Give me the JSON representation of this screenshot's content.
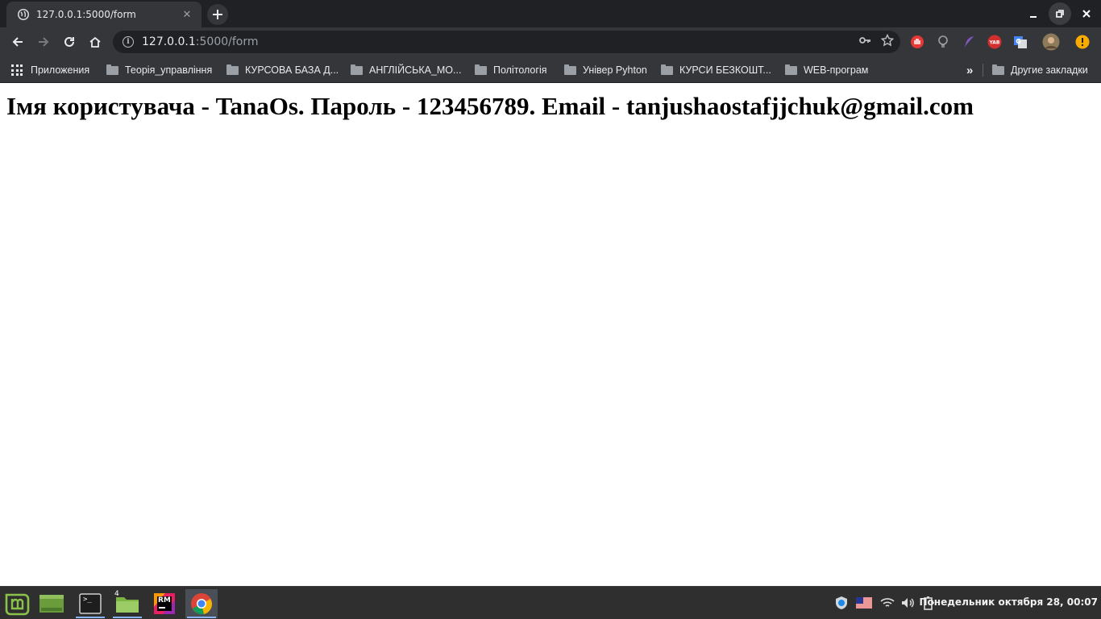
{
  "browser": {
    "tab": {
      "title": "127.0.0.1:5000/form",
      "close": "✕"
    },
    "new_tab": "+",
    "address": {
      "host": "127.0.0.1",
      "rest": ":5000/form"
    },
    "window_controls": {
      "minimize": "–",
      "restore": "⧉",
      "close": "✕"
    }
  },
  "bookmarks": {
    "apps_label": "Приложения",
    "items": [
      {
        "label": "Теорія_управління"
      },
      {
        "label": "КУРСОВА БАЗА Д..."
      },
      {
        "label": "АНГЛІЙСЬКА_МО..."
      },
      {
        "label": "Політологія"
      },
      {
        "label": "Універ Pyhton"
      },
      {
        "label": "КУРСИ БЕЗКОШТ..."
      },
      {
        "label": "WEB-програм"
      }
    ],
    "overflow": "»",
    "other_label": "Другие закладки"
  },
  "page": {
    "heading": "Імя користувача - TanaOs. Пароль - 123456789. Email - tanjushaostafjjchuk@gmail.com"
  },
  "taskbar": {
    "files_badge": "4",
    "rm_label": "RM",
    "terminal_prompt": ">_",
    "clock": "Понедельник октября 28, 00:07"
  },
  "colors": {
    "tab_strip": "#202124",
    "toolbar": "#35363a",
    "taskbar": "#2f2f2f",
    "mint_green": "#8bc34a"
  }
}
